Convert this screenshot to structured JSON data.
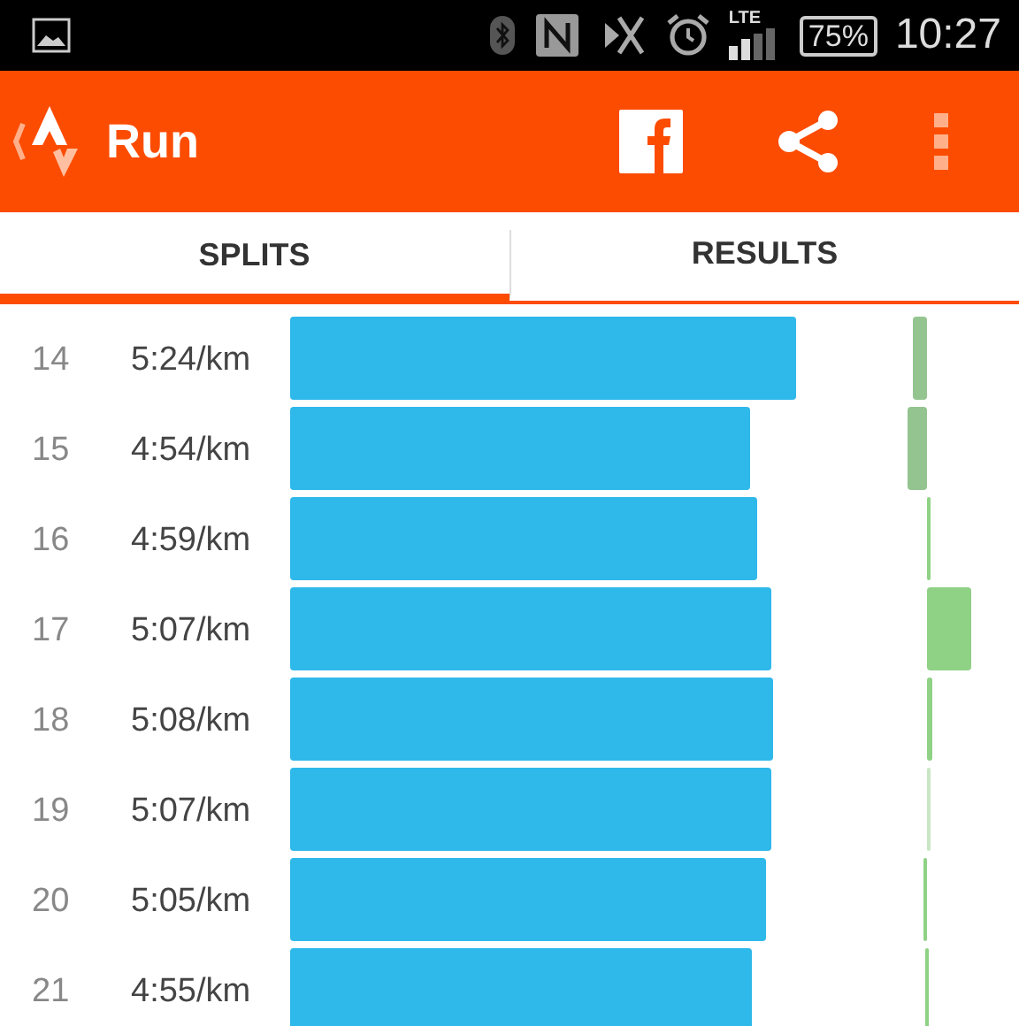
{
  "status_bar": {
    "network": "LTE",
    "battery": "75%",
    "time": "10:27"
  },
  "app_bar": {
    "title": "Run"
  },
  "tabs": [
    {
      "label": "SPLITS",
      "selected": true
    },
    {
      "label": "RESULTS",
      "selected": false
    }
  ],
  "splits": [
    {
      "km": "14",
      "pace": "5:24/km"
    },
    {
      "km": "15",
      "pace": "4:54/km"
    },
    {
      "km": "16",
      "pace": "4:59/km"
    },
    {
      "km": "17",
      "pace": "5:07/km"
    },
    {
      "km": "18",
      "pace": "5:08/km"
    },
    {
      "km": "19",
      "pace": "5:07/km"
    },
    {
      "km": "20",
      "pace": "5:05/km"
    },
    {
      "km": "21",
      "pace": "4:55/km"
    }
  ]
}
